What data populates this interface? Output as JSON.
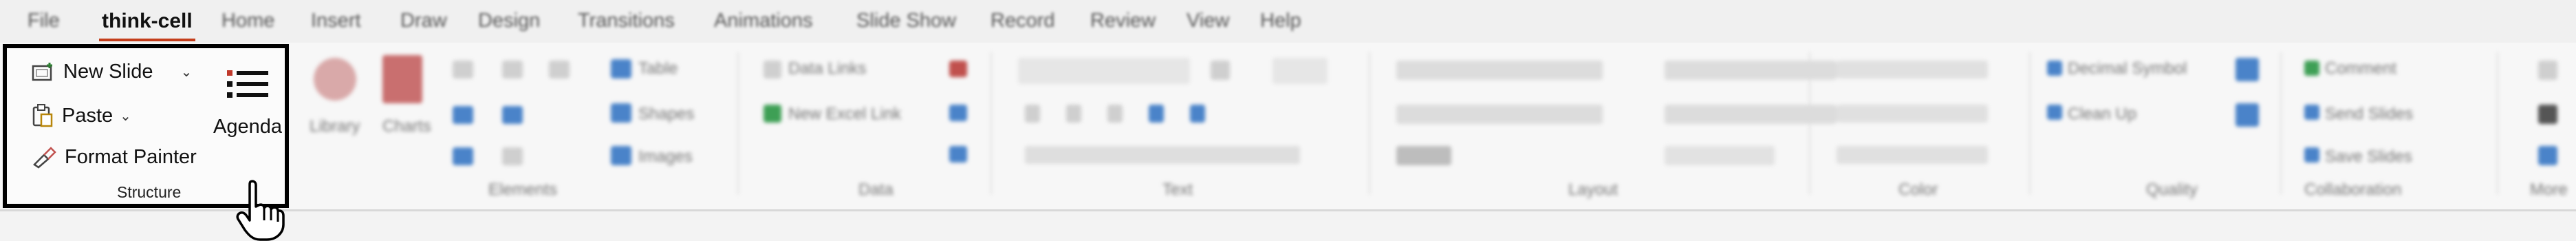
{
  "tabs": [
    {
      "label": "File",
      "active": false
    },
    {
      "label": "think-cell",
      "active": true
    },
    {
      "label": "Home",
      "active": false
    },
    {
      "label": "Insert",
      "active": false
    },
    {
      "label": "Draw",
      "active": false
    },
    {
      "label": "Design",
      "active": false
    },
    {
      "label": "Transitions",
      "active": false
    },
    {
      "label": "Animations",
      "active": false
    },
    {
      "label": "Slide Show",
      "active": false
    },
    {
      "label": "Record",
      "active": false
    },
    {
      "label": "Review",
      "active": false
    },
    {
      "label": "View",
      "active": false
    },
    {
      "label": "Help",
      "active": false
    }
  ],
  "structure": {
    "new_slide": "New Slide",
    "paste": "Paste",
    "format_painter": "Format Painter",
    "agenda": "Agenda",
    "group_label": "Structure"
  },
  "blurred": {
    "library": "Library",
    "charts": "Charts",
    "table": "Table",
    "shapes": "Shapes",
    "images": "Images",
    "data_links": "Data Links",
    "new_excel_link": "New Excel Link",
    "decimal_symbol": "Decimal Symbol",
    "clean_up": "Clean Up",
    "comment": "Comment",
    "send_slides": "Send Slides",
    "save_slides": "Save Slides",
    "group_labels": [
      "Elements",
      "Data",
      "Text",
      "Layout",
      "Color",
      "Quality",
      "Collaboration",
      "More"
    ]
  },
  "colors": {
    "active_tab_underline": "#c43e1c",
    "highlight_border": "#000000"
  }
}
